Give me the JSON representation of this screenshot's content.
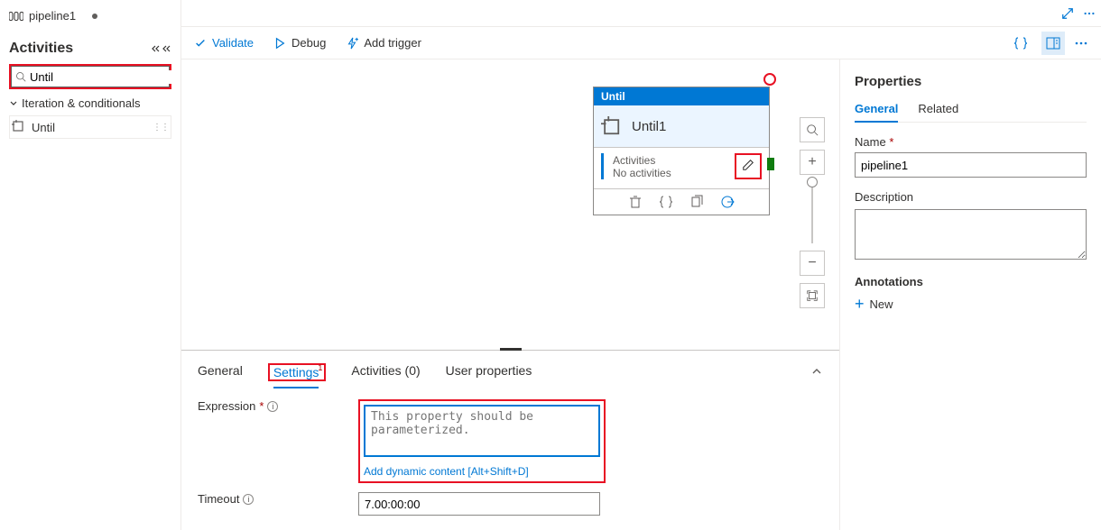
{
  "sidebar": {
    "tab_name": "pipeline1",
    "activities_heading": "Activities",
    "search_value": "Until",
    "category": "Iteration & conditionals",
    "item_label": "Until"
  },
  "toolbar": {
    "validate": "Validate",
    "debug": "Debug",
    "add_trigger": "Add trigger"
  },
  "node": {
    "type": "Until",
    "name": "Until1",
    "activities_label": "Activities",
    "activities_status": "No activities"
  },
  "bottom": {
    "tabs": {
      "general": "General",
      "settings": "Settings",
      "settings_badge": "1",
      "activities": "Activities (0)",
      "user_props": "User properties"
    },
    "expression_label": "Expression",
    "expression_placeholder": "This property should be parameterized.",
    "dynamic_link": "Add dynamic content [Alt+Shift+D]",
    "timeout_label": "Timeout",
    "timeout_value": "7.00:00:00"
  },
  "props": {
    "heading": "Properties",
    "tab_general": "General",
    "tab_related": "Related",
    "name_label": "Name",
    "name_value": "pipeline1",
    "desc_label": "Description",
    "annotations_label": "Annotations",
    "new_label": "New"
  }
}
